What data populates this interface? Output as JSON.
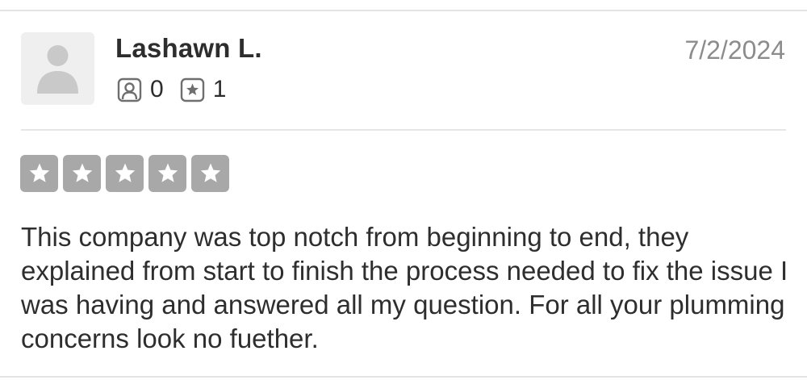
{
  "review": {
    "reviewer": {
      "name": "Lashawn L.",
      "avatar_icon": "default-user-avatar-icon",
      "friends_count": "0",
      "friends_icon": "user-profile-icon",
      "reviews_count": "1",
      "reviews_icon": "star-badge-icon"
    },
    "date": "7/2/2024",
    "rating": {
      "value": 5,
      "max": 5,
      "star_color": "#a8a8a8"
    },
    "text": "This company was top notch from beginning to end, they explained from start to finish the process needed to fix the issue I was having and answered all my question. For all your plumming concerns look no fuether."
  }
}
